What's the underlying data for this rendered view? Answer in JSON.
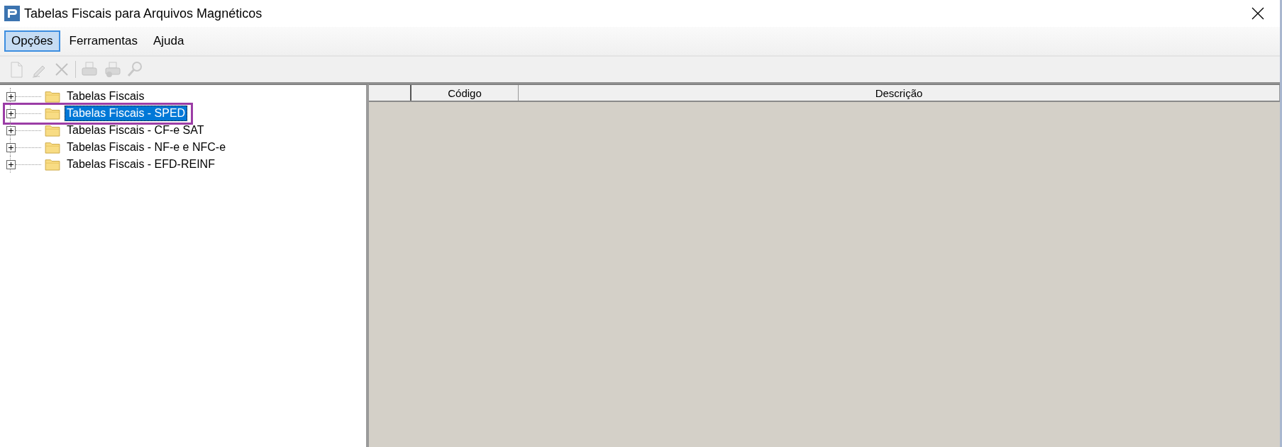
{
  "window": {
    "title": "Tabelas Fiscais para Arquivos Magnéticos"
  },
  "menu": [
    {
      "label": "Opções",
      "selected": true
    },
    {
      "label": "Ferramentas",
      "selected": false
    },
    {
      "label": "Ajuda",
      "selected": false
    }
  ],
  "toolbar": [
    {
      "kind": "new",
      "disabled": true
    },
    {
      "kind": "edit",
      "disabled": true
    },
    {
      "kind": "delete",
      "disabled": true
    },
    {
      "kind": "separator"
    },
    {
      "kind": "print",
      "disabled": true
    },
    {
      "kind": "print-setup",
      "disabled": true
    },
    {
      "kind": "search",
      "disabled": true
    }
  ],
  "tree": [
    {
      "label": "Tabelas Fiscais",
      "selected": false,
      "expanded": false,
      "highlighted": false
    },
    {
      "label": "Tabelas Fiscais - SPED",
      "selected": true,
      "expanded": false,
      "highlighted": true
    },
    {
      "label": "Tabelas Fiscais - CF-e SAT",
      "selected": false,
      "expanded": false,
      "highlighted": false
    },
    {
      "label": "Tabelas Fiscais - NF-e e NFC-e",
      "selected": false,
      "expanded": false,
      "highlighted": false
    },
    {
      "label": "Tabelas Fiscais - EFD-REINF",
      "selected": false,
      "expanded": false,
      "highlighted": false
    }
  ],
  "table": {
    "columns": [
      "Código",
      "Descrição"
    ]
  }
}
